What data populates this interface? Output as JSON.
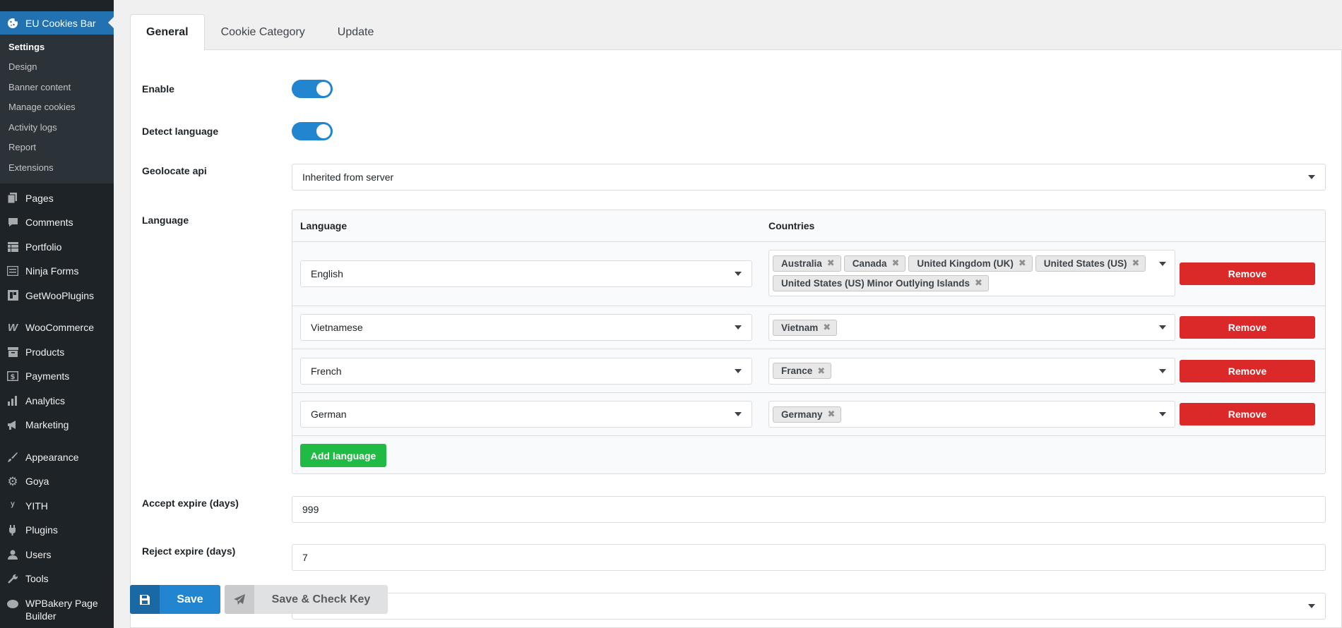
{
  "sidebar": {
    "active": {
      "label": "EU Cookies Bar",
      "icon": "cookie-icon"
    },
    "submenu": [
      {
        "label": "Settings",
        "current": true
      },
      {
        "label": "Design"
      },
      {
        "label": "Banner content"
      },
      {
        "label": "Manage cookies"
      },
      {
        "label": "Activity logs"
      },
      {
        "label": "Report"
      },
      {
        "label": "Extensions"
      }
    ],
    "menu": [
      {
        "label": "Pages",
        "icon": "pages-icon"
      },
      {
        "label": "Comments",
        "icon": "comments-icon"
      },
      {
        "label": "Portfolio",
        "icon": "portfolio-icon"
      },
      {
        "label": "Ninja Forms",
        "icon": "ninja-forms-icon"
      },
      {
        "label": "GetWooPlugins",
        "icon": "getwooplugins-icon"
      },
      {
        "label": "WooCommerce",
        "icon": "woocommerce-icon"
      },
      {
        "label": "Products",
        "icon": "products-icon"
      },
      {
        "label": "Payments",
        "icon": "payments-icon"
      },
      {
        "label": "Analytics",
        "icon": "analytics-icon"
      },
      {
        "label": "Marketing",
        "icon": "marketing-icon"
      },
      {
        "label": "Appearance",
        "icon": "appearance-icon"
      },
      {
        "label": "Goya",
        "icon": "goya-icon"
      },
      {
        "label": "YITH",
        "icon": "yith-icon"
      },
      {
        "label": "Plugins",
        "icon": "plugins-icon"
      },
      {
        "label": "Users",
        "icon": "users-icon"
      },
      {
        "label": "Tools",
        "icon": "tools-icon"
      },
      {
        "label": "WPBakery Page Builder",
        "icon": "wpbakery-icon"
      }
    ]
  },
  "tabs": [
    {
      "label": "General",
      "active": true
    },
    {
      "label": "Cookie Category"
    },
    {
      "label": "Update"
    }
  ],
  "form": {
    "enable": {
      "label": "Enable",
      "on": true
    },
    "detect_language": {
      "label": "Detect language",
      "on": true
    },
    "geolocate": {
      "label": "Geolocate api",
      "value": "Inherited from server"
    },
    "language": {
      "label": "Language",
      "header_language": "Language",
      "header_countries": "Countries",
      "rows": [
        {
          "language": "English",
          "countries": [
            "Australia",
            "Canada",
            "United Kingdom (UK)",
            "United States (US)",
            "United States (US) Minor Outlying Islands"
          ]
        },
        {
          "language": "Vietnamese",
          "countries": [
            "Vietnam"
          ]
        },
        {
          "language": "French",
          "countries": [
            "France"
          ]
        },
        {
          "language": "German",
          "countries": [
            "Germany"
          ]
        }
      ],
      "remove_label": "Remove",
      "add_label": "Add language"
    },
    "accept_expire": {
      "label": "Accept expire (days)",
      "value": "999"
    },
    "reject_expire": {
      "label": "Reject expire (days)",
      "value": "7"
    }
  },
  "buttons": {
    "save": "Save",
    "save_check": "Save & Check Key"
  },
  "colors": {
    "sidebar_bg": "#1d2327",
    "accent_blue": "#2185d0",
    "remove_red": "#db2828",
    "add_green": "#21ba45"
  }
}
